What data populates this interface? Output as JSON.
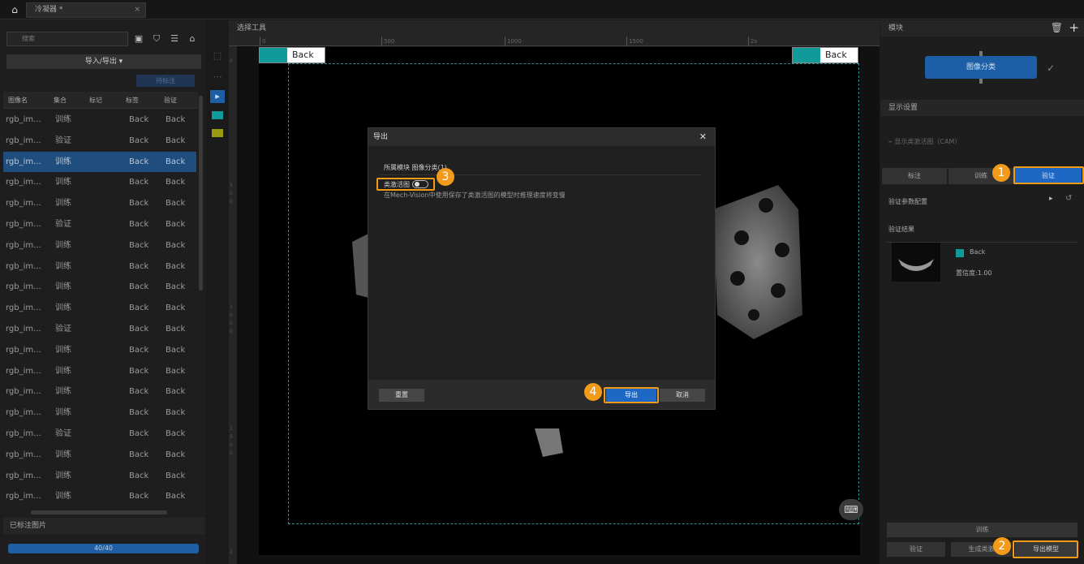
{
  "topbar": {
    "tab_title": "冷凝器 *",
    "home_icon": "home-icon",
    "tab_close": "×"
  },
  "left": {
    "search_placeholder": "搜索",
    "import_export": "导入/导出 ▾",
    "to_label": "待标注",
    "columns": [
      "图像名",
      "集合",
      "标记",
      "标签",
      "验证"
    ],
    "rows": [
      {
        "name": "rgb_im...",
        "set": "训练",
        "mark": "",
        "label": "Back",
        "verify": "Back"
      },
      {
        "name": "rgb_im...",
        "set": "验证",
        "mark": "",
        "label": "Back",
        "verify": "Back"
      },
      {
        "name": "rgb_im...",
        "set": "训练",
        "mark": "",
        "label": "Back",
        "verify": "Back"
      },
      {
        "name": "rgb_im...",
        "set": "训练",
        "mark": "",
        "label": "Back",
        "verify": "Back"
      },
      {
        "name": "rgb_im...",
        "set": "训练",
        "mark": "",
        "label": "Back",
        "verify": "Back"
      },
      {
        "name": "rgb_im...",
        "set": "验证",
        "mark": "",
        "label": "Back",
        "verify": "Back"
      },
      {
        "name": "rgb_im...",
        "set": "训练",
        "mark": "",
        "label": "Back",
        "verify": "Back"
      },
      {
        "name": "rgb_im...",
        "set": "训练",
        "mark": "",
        "label": "Back",
        "verify": "Back"
      },
      {
        "name": "rgb_im...",
        "set": "训练",
        "mark": "",
        "label": "Back",
        "verify": "Back"
      },
      {
        "name": "rgb_im...",
        "set": "训练",
        "mark": "",
        "label": "Back",
        "verify": "Back"
      },
      {
        "name": "rgb_im...",
        "set": "验证",
        "mark": "",
        "label": "Back",
        "verify": "Back"
      },
      {
        "name": "rgb_im...",
        "set": "训练",
        "mark": "",
        "label": "Back",
        "verify": "Back"
      },
      {
        "name": "rgb_im...",
        "set": "训练",
        "mark": "",
        "label": "Back",
        "verify": "Back"
      },
      {
        "name": "rgb_im...",
        "set": "训练",
        "mark": "",
        "label": "Back",
        "verify": "Back"
      },
      {
        "name": "rgb_im...",
        "set": "训练",
        "mark": "",
        "label": "Back",
        "verify": "Back"
      },
      {
        "name": "rgb_im...",
        "set": "验证",
        "mark": "",
        "label": "Back",
        "verify": "Back"
      },
      {
        "name": "rgb_im...",
        "set": "训练",
        "mark": "",
        "label": "Back",
        "verify": "Back"
      },
      {
        "name": "rgb_im...",
        "set": "训练",
        "mark": "",
        "label": "Back",
        "verify": "Back"
      },
      {
        "name": "rgb_im...",
        "set": "训练",
        "mark": "",
        "label": "Back",
        "verify": "Back"
      }
    ],
    "selected_row": 2,
    "labeled_images": "已标注图片",
    "progress": "40/40",
    "progress_fraction": 1.0
  },
  "center": {
    "title": "选择工具",
    "ruler_ticks": [
      "0",
      "500",
      "1000",
      "1500",
      "2s"
    ],
    "left_ticks": [
      "0",
      "5",
      "0",
      "0",
      "1",
      "0",
      "0",
      "0",
      "1",
      "5",
      "0",
      "0",
      "2"
    ],
    "label_left": "Back",
    "label_right": "Back",
    "label_color": "#119a9a"
  },
  "right": {
    "header": "模块",
    "module_name": "图像分类",
    "display_settings": "显示设置",
    "cam_toggle": "显示类激活图（CAM）",
    "tabs": [
      "标注",
      "训练",
      "验证"
    ],
    "verify_config": "验证参数配置",
    "verify_result": "验证结果",
    "result_label": "Back",
    "confidence": "置信度:1.00",
    "train_btn": "训练",
    "bottom_buttons": [
      "验证",
      "生成类激",
      "导出模型"
    ]
  },
  "dialog": {
    "title": "导出",
    "module": "所属模块  图像分类(1)",
    "cam_label": "类激活图",
    "note": "在Mech-Vision中使用保存了类激活图的模型时推理速度将变慢",
    "reset": "重置",
    "export": "导出",
    "cancel": "取消"
  },
  "badges": [
    "1",
    "2",
    "3",
    "4"
  ],
  "colors": {
    "accent": "#1d68c4",
    "highlight": "#f29a1a",
    "teal": "#119a9a"
  }
}
